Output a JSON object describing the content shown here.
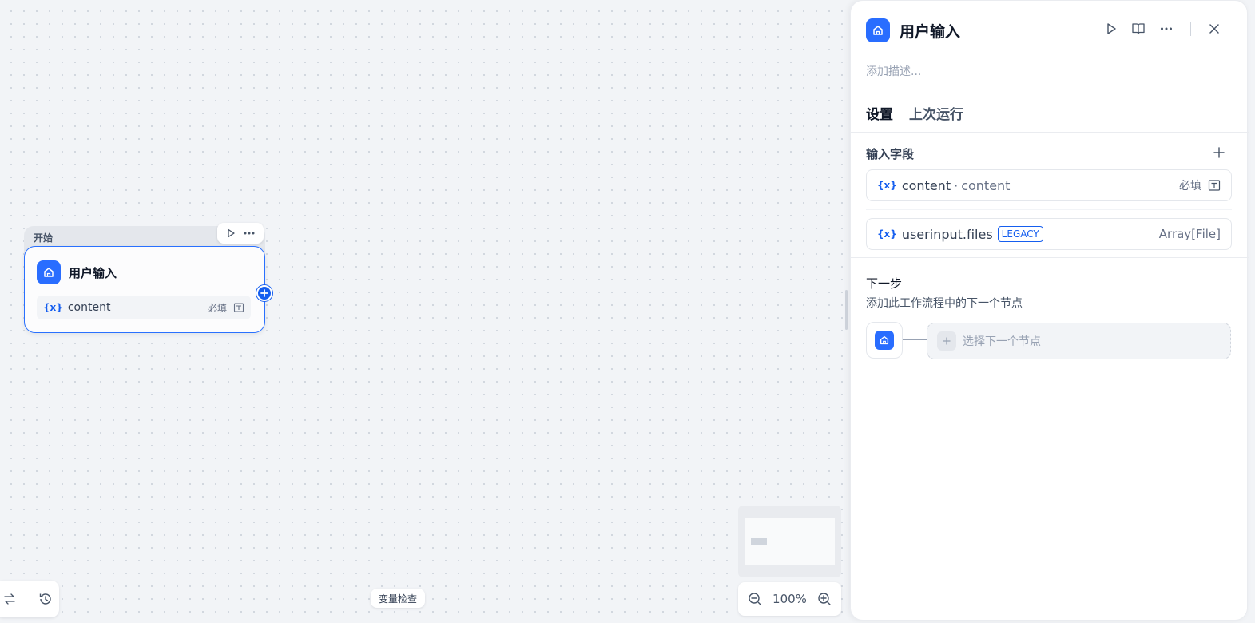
{
  "canvas": {
    "node": {
      "header_label": "开始",
      "title": "用户输入",
      "variable": {
        "symbol": "{x}",
        "name": "content",
        "required": "必填"
      }
    },
    "variable_inspect_label": "变量检查",
    "zoom_level": "100%"
  },
  "panel": {
    "title": "用户输入",
    "description_placeholder": "添加描述...",
    "tabs": [
      {
        "label": "设置",
        "active": true
      },
      {
        "label": "上次运行",
        "active": false
      }
    ],
    "input_fields": {
      "title": "输入字段",
      "items": [
        {
          "symbol": "{x}",
          "name": "content",
          "separator": "·",
          "label": "content",
          "required": "必填"
        },
        {
          "symbol": "{x}",
          "name": "userinput.files",
          "badge": "LEGACY",
          "type": "Array[File]"
        }
      ]
    },
    "next_step": {
      "title": "下一步",
      "description": "添加此工作流程中的下一个节点",
      "select_placeholder": "选择下一个节点"
    }
  },
  "colors": {
    "accent": "#155eef",
    "node_icon_bg": "#296dff",
    "canvas_bg": "#f2f4f7"
  },
  "icons": [
    "home-icon",
    "play-icon",
    "more-icon",
    "book-icon",
    "close-icon",
    "plus-icon",
    "zoom-in-icon",
    "zoom-out-icon",
    "history-icon",
    "swap-icon",
    "text-field-icon"
  ]
}
